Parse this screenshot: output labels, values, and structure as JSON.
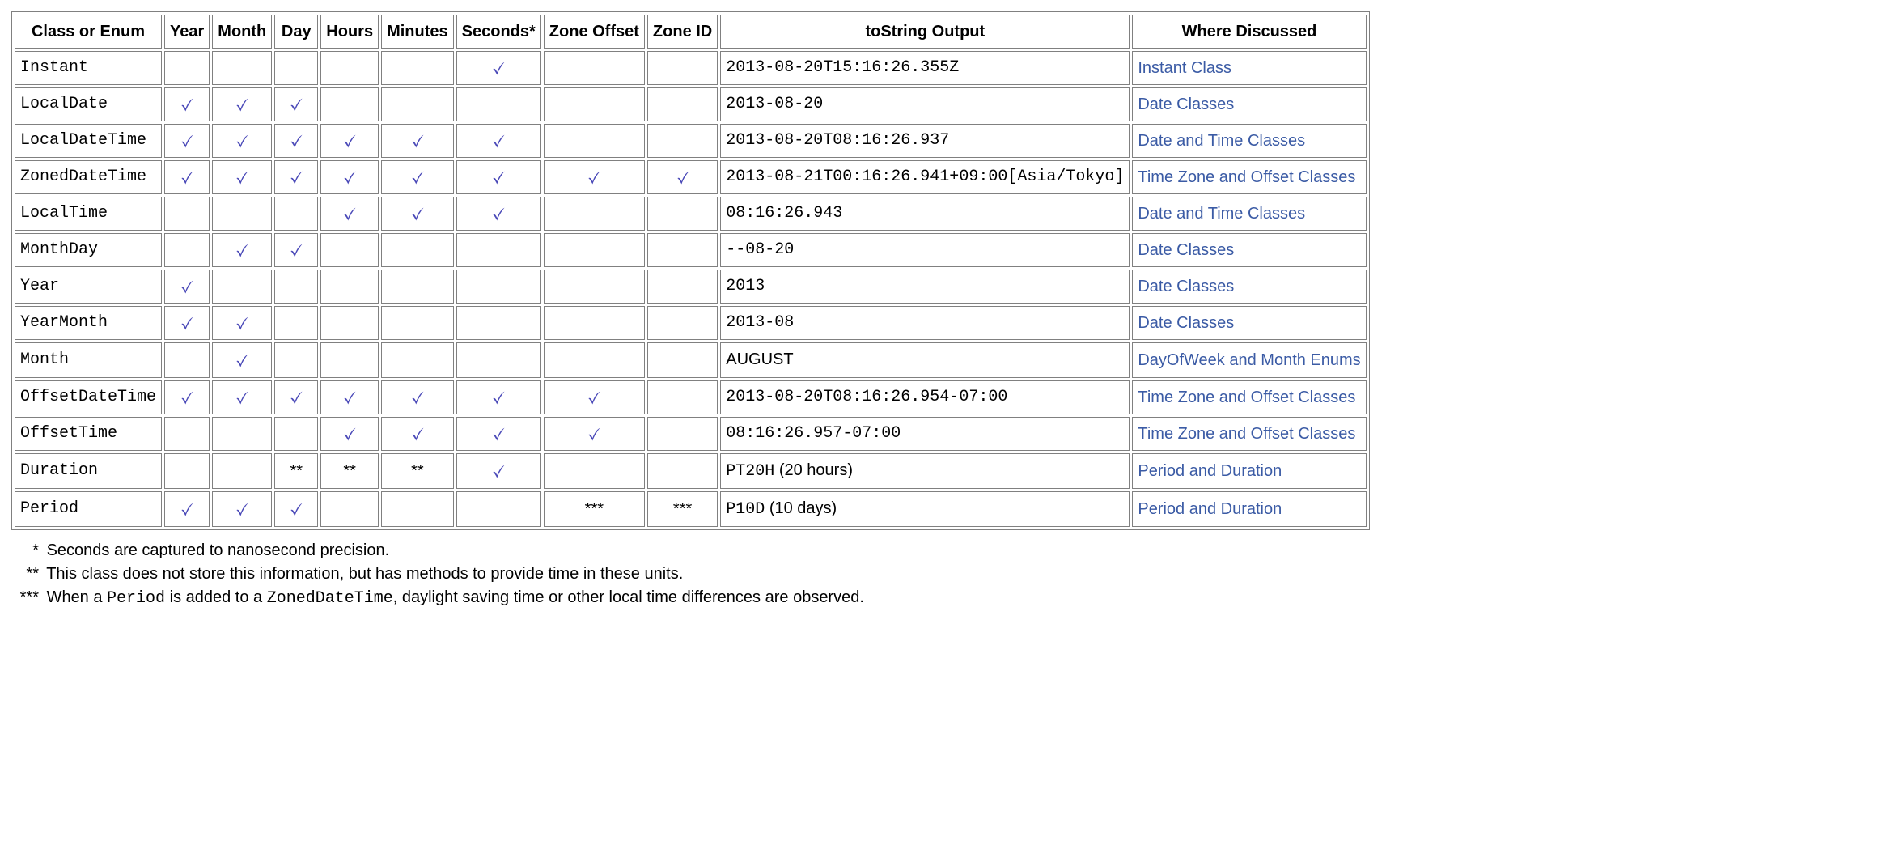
{
  "columns": [
    "Class or Enum",
    "Year",
    "Month",
    "Day",
    "Hours",
    "Minutes",
    "Seconds*",
    "Zone Offset",
    "Zone ID",
    "toString Output",
    "Where Discussed"
  ],
  "rows": [
    {
      "name": "Instant",
      "marks": [
        "",
        "",
        "",
        "",
        "",
        "✓",
        "",
        ""
      ],
      "output": "2013-08-20T15:16:26.355Z",
      "link": "Instant Class"
    },
    {
      "name": "LocalDate",
      "marks": [
        "✓",
        "✓",
        "✓",
        "",
        "",
        "",
        "",
        ""
      ],
      "output": "2013-08-20",
      "link": "Date Classes"
    },
    {
      "name": "LocalDateTime",
      "marks": [
        "✓",
        "✓",
        "✓",
        "✓",
        "✓",
        "✓",
        "",
        ""
      ],
      "output": "2013-08-20T08:16:26.937",
      "link": "Date and Time Classes"
    },
    {
      "name": "ZonedDateTime",
      "marks": [
        "✓",
        "✓",
        "✓",
        "✓",
        "✓",
        "✓",
        "✓",
        "✓"
      ],
      "output": "2013-08-21T00:16:26.941+09:00[Asia/Tokyo]",
      "link": "Time Zone and Offset Classes"
    },
    {
      "name": "LocalTime",
      "marks": [
        "",
        "",
        "",
        "✓",
        "✓",
        "✓",
        "",
        ""
      ],
      "output": "08:16:26.943",
      "link": "Date and Time Classes"
    },
    {
      "name": "MonthDay",
      "marks": [
        "",
        "✓",
        "✓",
        "",
        "",
        "",
        "",
        ""
      ],
      "output": "--08-20",
      "link": "Date Classes"
    },
    {
      "name": "Year",
      "marks": [
        "✓",
        "",
        "",
        "",
        "",
        "",
        "",
        ""
      ],
      "output": "2013",
      "link": "Date Classes"
    },
    {
      "name": "YearMonth",
      "marks": [
        "✓",
        "✓",
        "",
        "",
        "",
        "",
        "",
        ""
      ],
      "output": "2013-08",
      "link": "Date Classes"
    },
    {
      "name": "Month",
      "marks": [
        "",
        "✓",
        "",
        "",
        "",
        "",
        "",
        ""
      ],
      "output": "AUGUST",
      "output_prose": "",
      "link": "DayOfWeek and Month Enums",
      "output_plain": true
    },
    {
      "name": "OffsetDateTime",
      "marks": [
        "✓",
        "✓",
        "✓",
        "✓",
        "✓",
        "✓",
        "✓",
        ""
      ],
      "output": "2013-08-20T08:16:26.954-07:00",
      "link": "Time Zone and Offset Classes"
    },
    {
      "name": "OffsetTime",
      "marks": [
        "",
        "",
        "",
        "✓",
        "✓",
        "✓",
        "✓",
        ""
      ],
      "output": "08:16:26.957-07:00",
      "link": "Time Zone and Offset Classes"
    },
    {
      "name": "Duration",
      "marks": [
        "",
        "",
        "**",
        "**",
        "**",
        "✓",
        "",
        ""
      ],
      "output": "PT20H",
      "output_prose": " (20 hours)",
      "link": "Period and Duration"
    },
    {
      "name": "Period",
      "marks": [
        "✓",
        "✓",
        "✓",
        "",
        "",
        "",
        "***",
        "***"
      ],
      "output": "P10D",
      "output_prose": " (10 days)",
      "link": "Period and Duration"
    }
  ],
  "notes": {
    "n1_stars": "*",
    "n1_text": "Seconds are captured to nanosecond precision.",
    "n2_stars": "**",
    "n2_text": "This class does not store this information, but has methods to provide time in these units.",
    "n3_stars": "***",
    "n3_pre": "When a ",
    "n3_code1": "Period",
    "n3_mid": " is added to a ",
    "n3_code2": "ZonedDateTime",
    "n3_post": ", daylight saving time or other local time differences are observed."
  }
}
